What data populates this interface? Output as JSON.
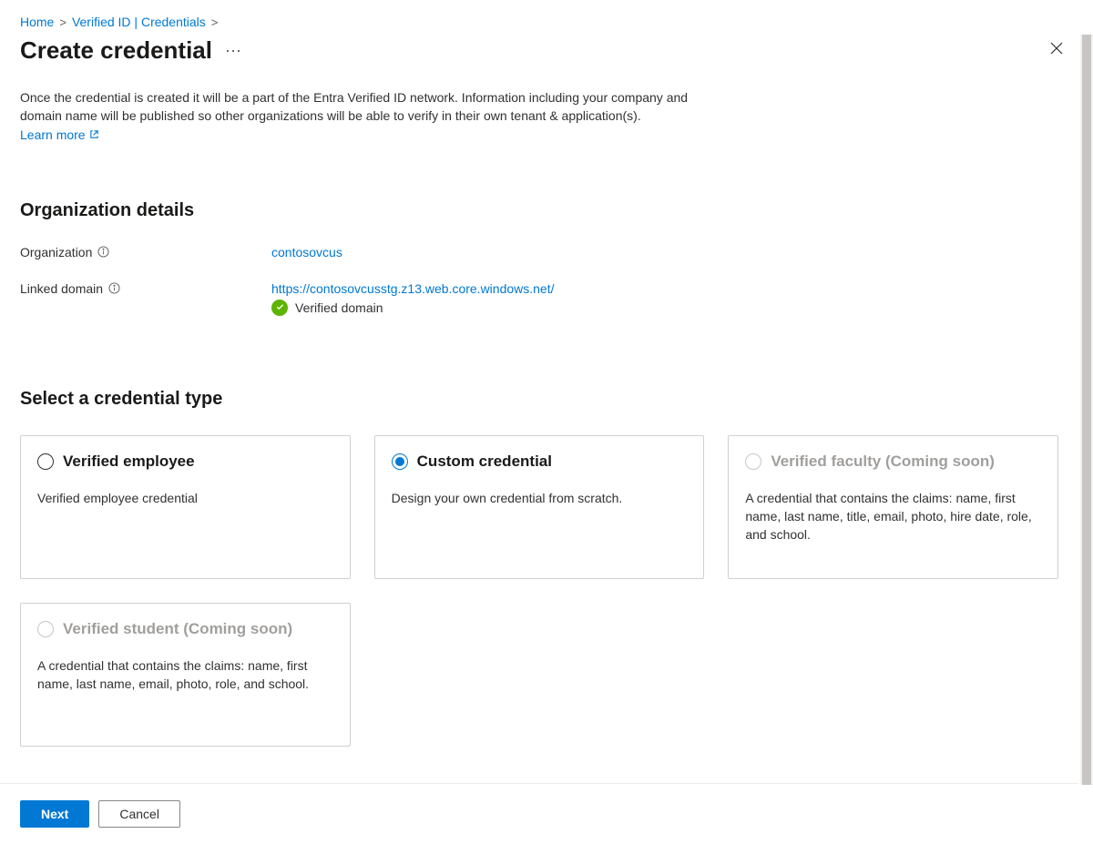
{
  "breadcrumb": {
    "home": "Home",
    "verified_id": "Verified ID | Credentials"
  },
  "header": {
    "title": "Create credential"
  },
  "intro": {
    "text": "Once the credential is created it will be a part of the Entra Verified ID network. Information including your company and domain name will be published so other organizations will be able to verify in their own tenant & application(s).",
    "learn_more": "Learn more"
  },
  "org_section": {
    "title": "Organization details",
    "org_label": "Organization",
    "org_value": "contosovcus",
    "domain_label": "Linked domain",
    "domain_value": "https://contosovcusstg.z13.web.core.windows.net/",
    "verified_text": "Verified domain"
  },
  "cred_section": {
    "title": "Select a credential type"
  },
  "cards": [
    {
      "title": "Verified employee",
      "desc": "Verified employee credential",
      "selected": false,
      "disabled": false
    },
    {
      "title": "Custom credential",
      "desc": "Design your own credential from scratch.",
      "selected": true,
      "disabled": false
    },
    {
      "title": "Verified faculty (Coming soon)",
      "desc": "A credential that contains the claims: name, first name, last name, title, email, photo, hire date, role, and school.",
      "selected": false,
      "disabled": true
    },
    {
      "title": "Verified student (Coming soon)",
      "desc": "A credential that contains the claims: name, first name, last name, email, photo, role, and school.",
      "selected": false,
      "disabled": true
    }
  ],
  "footer": {
    "next": "Next",
    "cancel": "Cancel"
  }
}
